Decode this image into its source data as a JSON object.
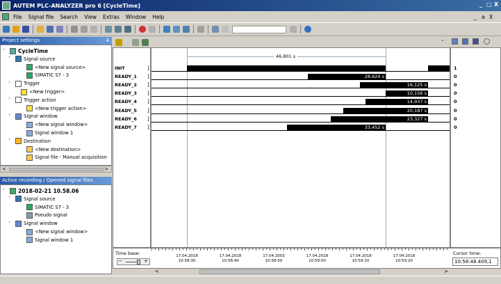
{
  "window": {
    "title": "AUTEM  PLC-ANALYZER pro 6 [CycleTime]",
    "controls": [
      "_",
      "□",
      "X"
    ],
    "doc_controls": [
      "_",
      "ə",
      "X"
    ]
  },
  "menu": [
    "File",
    "Signal file",
    "Search",
    "View",
    "Extras",
    "Window",
    "Help"
  ],
  "project_panel": {
    "title": "Project settings",
    "pin": "4",
    "items": [
      {
        "label": "CycleTime",
        "icon": "project-icon",
        "depth": 0,
        "bold": true,
        "expand": "˅"
      },
      {
        "label": "Signal source",
        "icon": "signal-source-icon",
        "depth": 1,
        "expand": "˅"
      },
      {
        "label": "<New signal source>",
        "icon": "new-source-icon",
        "depth": 3,
        "expand": ""
      },
      {
        "label": "SIMATIC S7 - 3",
        "icon": "plc-icon",
        "depth": 3,
        "expand": ""
      },
      {
        "label": "Trigger",
        "icon": "trigger-icon",
        "depth": 1,
        "expand": "˅"
      },
      {
        "label": "<New trigger>",
        "icon": "new-trigger-icon",
        "depth": 2,
        "expand": ""
      },
      {
        "label": "Trigger action",
        "icon": "trigger-action-icon",
        "depth": 1,
        "expand": "˅"
      },
      {
        "label": "<New trigger action>",
        "icon": "new-trigger-action-icon",
        "depth": 3,
        "expand": ""
      },
      {
        "label": "Signal window",
        "icon": "signal-window-icon",
        "depth": 1,
        "expand": "˅"
      },
      {
        "label": "<New signal window>",
        "icon": "window-icon",
        "depth": 3,
        "expand": ""
      },
      {
        "label": "Signal window 1",
        "icon": "window-icon",
        "depth": 3,
        "expand": ""
      },
      {
        "label": "Destination",
        "icon": "destination-icon",
        "depth": 1,
        "expand": "˅"
      },
      {
        "label": "<New destination>",
        "icon": "new-destination-icon",
        "depth": 3,
        "expand": ""
      },
      {
        "label": "Signal file - Manual acquisition",
        "icon": "file-icon",
        "depth": 3,
        "expand": ""
      }
    ],
    "scroll_left": "<",
    "scroll_right": ">"
  },
  "recording_panel": {
    "title": "Active recording / Opened signal files",
    "items": [
      {
        "label": "2018-02-21 10.58.06",
        "icon": "recording-icon",
        "depth": 0,
        "bold": true,
        "expand": "˅"
      },
      {
        "label": "Signal source",
        "icon": "signal-source-icon",
        "depth": 1,
        "expand": "˅"
      },
      {
        "label": "SIMATIC S7 - 3",
        "icon": "plc-icon",
        "depth": 3,
        "expand": ""
      },
      {
        "label": "Pseudo signal",
        "icon": "pseudo-signal-icon",
        "depth": 3,
        "expand": ""
      },
      {
        "label": "Signal window",
        "icon": "signal-window-icon",
        "depth": 1,
        "expand": "˅"
      },
      {
        "label": "<New signal window>",
        "icon": "window-icon",
        "depth": 3,
        "expand": ""
      },
      {
        "label": "Signal window 1",
        "icon": "window-icon",
        "depth": 3,
        "expand": ""
      }
    ]
  },
  "signal_window": {
    "dropdown_arrow": "˅",
    "overall_span_label": "46,801 s",
    "signals": [
      {
        "name": "INIT",
        "value": "1",
        "label": ""
      },
      {
        "name": "READY_1",
        "value": "0",
        "label": "28,624 s"
      },
      {
        "name": "READY_2",
        "value": "0",
        "label": "16,125 s"
      },
      {
        "name": "READY_3",
        "value": "0",
        "label": "10,156 s"
      },
      {
        "name": "READY_4",
        "value": "0",
        "label": "14,937 s"
      },
      {
        "name": "READY_5",
        "value": "0",
        "label": "20,187 s"
      },
      {
        "name": "READY_6",
        "value": "0",
        "label": "23,327 s"
      },
      {
        "name": "READY_7",
        "value": "0",
        "label": "33,452 s"
      }
    ],
    "time_base_label": "Time base:",
    "time_base_minus": "−",
    "time_base_plus": "+",
    "axis_ticks": [
      {
        "date": "17.04.2018",
        "time": "10:58:30"
      },
      {
        "date": "17.04.2018",
        "time": "10:58:40"
      },
      {
        "date": "17.04.2003",
        "time": "10:58:50"
      },
      {
        "date": "17.04.2018",
        "time": "10:59:00"
      },
      {
        "date": "17.04.2018",
        "time": "10:59:10"
      },
      {
        "date": "17.04.2018",
        "time": "10:59:20"
      }
    ],
    "cursor_time_label": "Cursor time:",
    "cursor_time_value": "10:58:48.409,1",
    "hscroll_left": "<",
    "hscroll_right": ">"
  },
  "colors": {
    "title_bar": "#0a246a",
    "panel_header": "#2a5aa8",
    "bar": "#000000",
    "background": "#d4d0c8"
  }
}
